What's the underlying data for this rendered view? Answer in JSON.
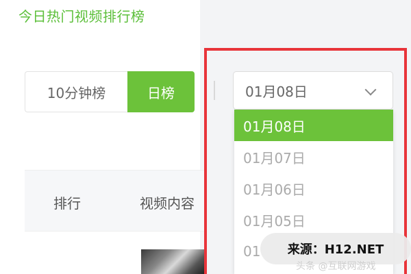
{
  "page_title": "今日热门视频排行榜",
  "tabs": [
    {
      "label": "10分钟榜",
      "active": false
    },
    {
      "label": "日榜",
      "active": true
    }
  ],
  "table_header": {
    "rank": "排行",
    "content": "视频内容"
  },
  "date_select": {
    "value": "01月08日",
    "options": [
      "01月08日",
      "01月07日",
      "01月06日",
      "01月05日",
      "01"
    ]
  },
  "watermark": {
    "text": "来源：H12.NET",
    "subtext": "头条 @互联网游戏"
  },
  "colors": {
    "accent_green": "#6cc23a",
    "title_green": "#5cbf3a",
    "highlight_red": "#e8343a"
  }
}
